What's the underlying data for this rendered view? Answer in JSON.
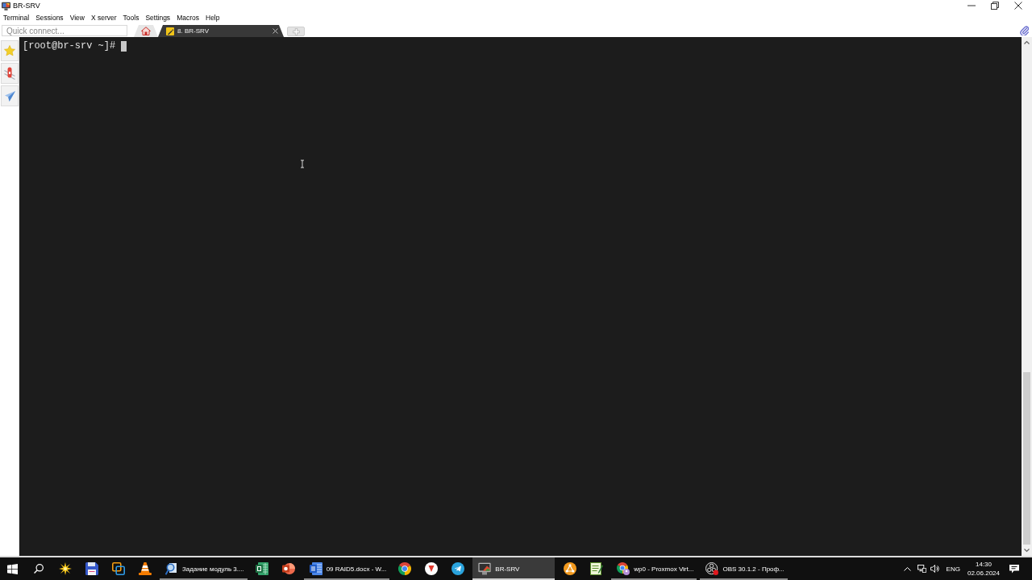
{
  "window": {
    "title": "BR-SRV"
  },
  "menu": [
    {
      "label": "Terminal"
    },
    {
      "label": "Sessions"
    },
    {
      "label": "View"
    },
    {
      "label": "X server"
    },
    {
      "label": "Tools"
    },
    {
      "label": "Settings"
    },
    {
      "label": "Macros"
    },
    {
      "label": "Help"
    }
  ],
  "toolbar": {
    "quick_connect": {
      "placeholder": "Quick connect..."
    },
    "tabs": [
      {
        "kind": "home",
        "selected": false
      },
      {
        "kind": "session",
        "label": "8. BR-SRV",
        "selected": true
      }
    ]
  },
  "terminal": {
    "prompt": "[root@br-srv ~]#"
  },
  "taskbar": {
    "items": [
      {
        "kind": "pinned",
        "selected": false
      },
      {
        "kind": "pinned",
        "selected": false
      },
      {
        "kind": "pinned",
        "selected": false
      },
      {
        "kind": "pinned",
        "selected": false
      },
      {
        "kind": "window",
        "label": "Задание модуль 3....",
        "selected": false
      },
      {
        "kind": "pinned",
        "selected": false
      },
      {
        "kind": "pinned",
        "selected": false
      },
      {
        "kind": "window",
        "label": "09 RAID5.docx - W...",
        "selected": false
      },
      {
        "kind": "pinned",
        "selected": false
      },
      {
        "kind": "pinned",
        "selected": false
      },
      {
        "kind": "pinned",
        "selected": false
      },
      {
        "kind": "window",
        "label": "BR-SRV",
        "selected": true
      },
      {
        "kind": "pinned",
        "selected": false
      },
      {
        "kind": "pinned",
        "selected": false
      },
      {
        "kind": "window",
        "label": "wp0 - Proxmox Virt...",
        "selected": false
      },
      {
        "kind": "window",
        "label": "OBS 30.1.2 - Проф...",
        "selected": false
      }
    ]
  },
  "tray": {
    "language": "ENG",
    "time": "14:30",
    "date": "02.06.2024"
  }
}
